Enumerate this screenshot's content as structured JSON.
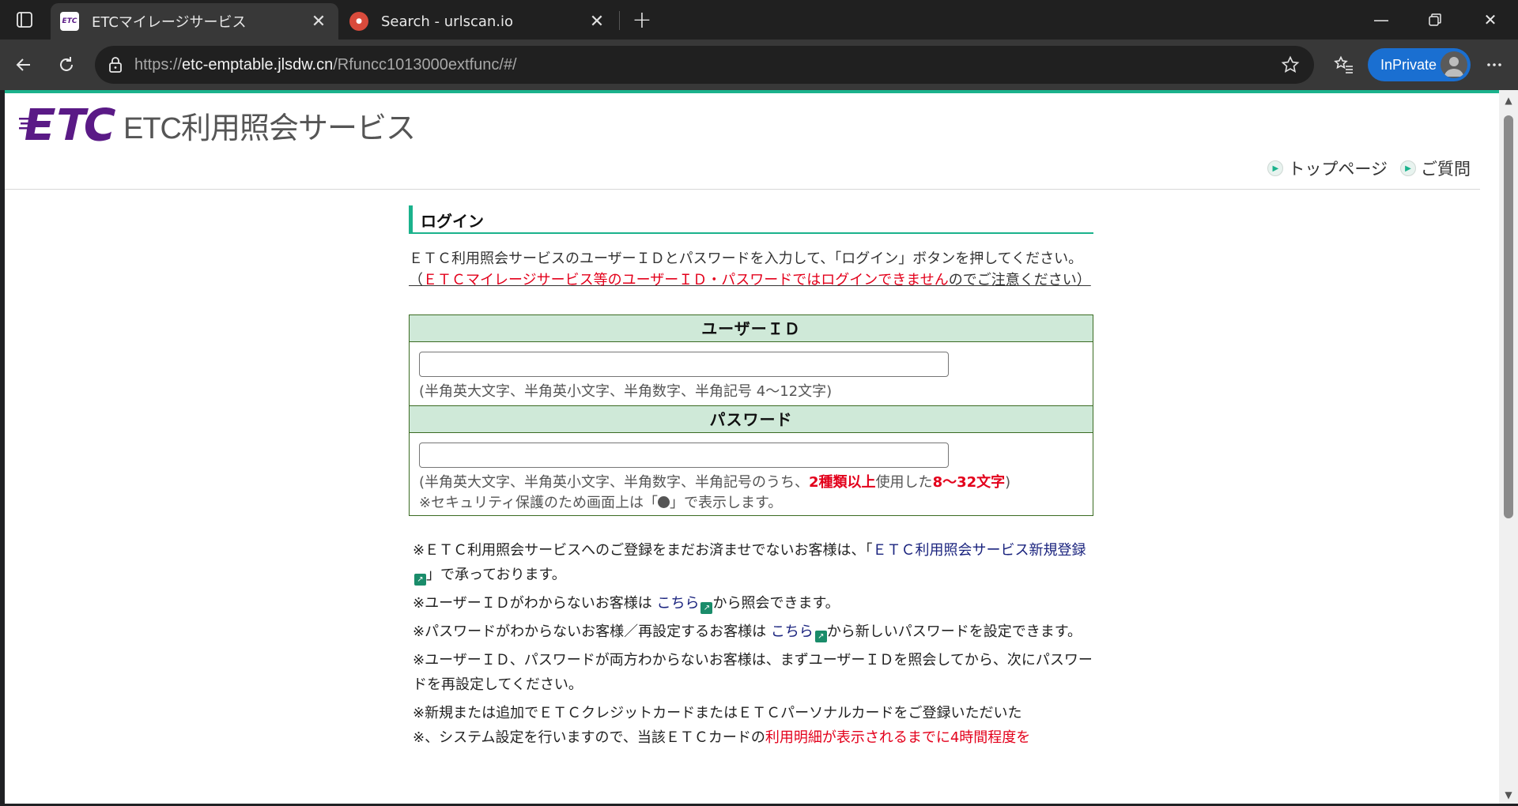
{
  "browser": {
    "tabs": [
      {
        "title": "ETCマイレージサービス",
        "favicon": "etc-favicon",
        "active": true
      },
      {
        "title": "Search - urlscan.io",
        "favicon": "urlscan-favicon",
        "active": false
      }
    ],
    "address": {
      "scheme": "https://",
      "host": "etc-emptable.jlsdw.cn",
      "path": "/Rfuncc1013000extfunc/#/"
    },
    "inprivate_label": "InPrivate"
  },
  "header": {
    "logo_text": "ETC利用照会サービス",
    "links": [
      "トップページ",
      "ご質問"
    ]
  },
  "login": {
    "title": "ログイン",
    "intro": "ＥＴＣ利用照会サービスのユーザーＩＤとパスワードを入力して、「ログイン」ボタンを押してください。",
    "warn_open": "（",
    "warn_red": "ＥＴＣマイレージサービス等のユーザーＩＤ・パスワードではログインできません",
    "warn_rest": "のでご注意ください）",
    "user_id": {
      "label": "ユーザーＩＤ",
      "value": "",
      "hint": "(半角英大文字、半角英小文字、半角数字、半角記号 4〜12文字)"
    },
    "password": {
      "label": "パスワード",
      "value": "",
      "hint_pre": "(半角英大文字、半角英小文字、半角数字、半角記号のうち、",
      "hint_red1": "2種類以上",
      "hint_mid": "使用した",
      "hint_red2": "8〜32文字",
      "hint_post": ")",
      "note_pre": "※セキュリティ保護のため画面上は「",
      "note_post": "」で表示します。"
    }
  },
  "notes": {
    "n1_pre": "※ＥＴＣ利用照会サービスへのご登録をまだお済ませでないお客様は、「",
    "n1_link": "ＥＴＣ利用照会サービス新規登録",
    "n1_post": "」で承っております。",
    "n2_pre": "※ユーザーＩＤがわからないお客様は ",
    "n2_link": "こちら",
    "n2_post": "から照会できます。",
    "n3_pre": "※パスワードがわからないお客様／再設定するお客様は ",
    "n3_link": "こちら",
    "n3_post": "から新しいパスワードを設定できます。",
    "n4": "※ユーザーＩＤ、パスワードが両方わからないお客様は、まずユーザーＩＤを照会してから、次にパスワードを再設定してください。",
    "n5": "※新規または追加でＥＴＣクレジットカードまたはＥＴＣパーソナルカードをご登録いただいた",
    "n6_pre": "※、システム設定を行いますので、当該ＥＴＣカードの",
    "n6_red": "利用明細が表示されるまでに4時間程度を"
  },
  "colors": {
    "accent": "#1bb28c",
    "header_bg": "#cfe9d8",
    "warning_red": "#e3001b",
    "link": "#1a237e",
    "inprivate": "#1a6fd1"
  }
}
